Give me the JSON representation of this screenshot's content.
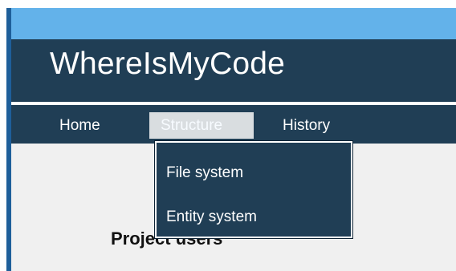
{
  "header": {
    "title": "WhereIsMyCode"
  },
  "nav": {
    "items": [
      {
        "label": "Home"
      },
      {
        "label": "Structure"
      },
      {
        "label": "History"
      }
    ],
    "active_item": "Structure",
    "active_color": "#d9dde0"
  },
  "dropdown": {
    "items": [
      {
        "label": "File system"
      },
      {
        "label": "Entity system"
      }
    ]
  },
  "main": {
    "heading": "Project users"
  },
  "colors": {
    "top_band": "#63b2ea",
    "brand_bar": "#203e55",
    "nav_bar": "#203e55",
    "dropdown": "#203e55",
    "page_background": "#f0f0f0",
    "left_edge": "#1e5f9a"
  }
}
